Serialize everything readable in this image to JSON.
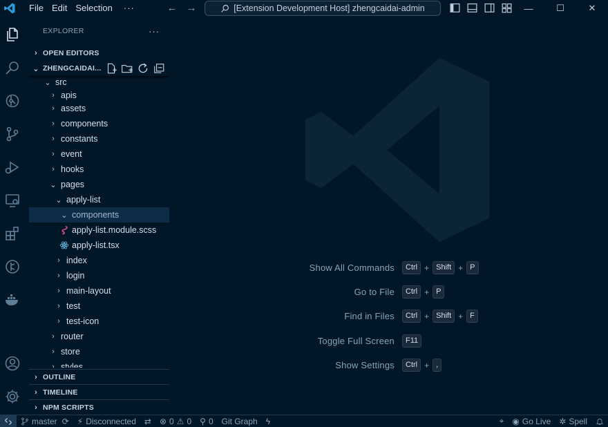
{
  "titlebar": {
    "menu": [
      "File",
      "Edit",
      "Selection",
      "···"
    ],
    "search_text": "[Extension Development Host] zhengcaidai-admin",
    "back_label": "←",
    "forward_label": "→",
    "minimize": "—",
    "maximize": "☐",
    "close": "✕"
  },
  "sidebar": {
    "title": "EXPLORER",
    "more": "···",
    "open_editors": "OPEN EDITORS",
    "project": "ZHENGCAIDAI...",
    "tree": [
      {
        "label": "src",
        "chev": "⌄",
        "depth": 0
      },
      {
        "label": "apis",
        "chev": "›",
        "depth": 1
      },
      {
        "label": "assets",
        "chev": "›",
        "depth": 1
      },
      {
        "label": "components",
        "chev": "›",
        "depth": 1
      },
      {
        "label": "constants",
        "chev": "›",
        "depth": 1
      },
      {
        "label": "event",
        "chev": "›",
        "depth": 1
      },
      {
        "label": "hooks",
        "chev": "›",
        "depth": 1
      },
      {
        "label": "pages",
        "chev": "⌄",
        "depth": 1
      },
      {
        "label": "apply-list",
        "chev": "⌄",
        "depth": 2
      },
      {
        "label": "components",
        "chev": "⌄",
        "depth": 3,
        "selected": true
      },
      {
        "label": "apply-list.module.scss",
        "icon": "sass-file-icon",
        "depth": 3
      },
      {
        "label": "apply-list.tsx",
        "icon": "react-file-icon",
        "depth": 3
      },
      {
        "label": "index",
        "chev": "›",
        "depth": 2
      },
      {
        "label": "login",
        "chev": "›",
        "depth": 2
      },
      {
        "label": "main-layout",
        "chev": "›",
        "depth": 2
      },
      {
        "label": "test",
        "chev": "›",
        "depth": 2
      },
      {
        "label": "test-icon",
        "chev": "›",
        "depth": 2
      },
      {
        "label": "router",
        "chev": "›",
        "depth": 1
      },
      {
        "label": "store",
        "chev": "›",
        "depth": 1
      },
      {
        "label": "styles",
        "chev": "›",
        "depth": 1
      }
    ],
    "outline": "OUTLINE",
    "timeline": "TIMELINE",
    "npm_scripts": "NPM SCRIPTS"
  },
  "editor": {
    "shortcuts": [
      {
        "label": "Show All Commands",
        "keys": [
          "Ctrl",
          "Shift",
          "P"
        ]
      },
      {
        "label": "Go to File",
        "keys": [
          "Ctrl",
          "P"
        ]
      },
      {
        "label": "Find in Files",
        "keys": [
          "Ctrl",
          "Shift",
          "F"
        ]
      },
      {
        "label": "Toggle Full Screen",
        "keys": [
          "F11"
        ]
      },
      {
        "label": "Show Settings",
        "keys": [
          "Ctrl",
          ","
        ]
      }
    ]
  },
  "statusbar": {
    "branch": "master",
    "connection": "Disconnected",
    "errors": "0",
    "warnings": "0",
    "ports": "0",
    "git_graph": "Git Graph",
    "go_live": "Go Live",
    "spell": "Spell"
  },
  "colors": {
    "background": "#011627",
    "accent": "#d6deeb",
    "selection": "#0d2c48",
    "sass": "#e44d8a",
    "react": "#61b5e0",
    "vscode_blue": "#2d9cdb"
  }
}
